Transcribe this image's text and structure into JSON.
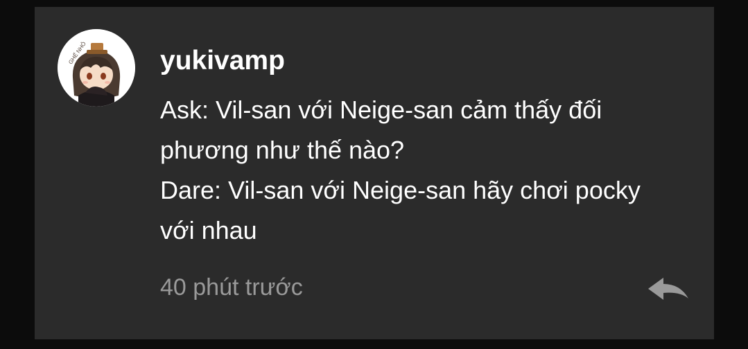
{
  "comment": {
    "username": "yukivamp",
    "message_lines": [
      "Ask: Vil-san với Neige-san cảm thấy đối",
      "phương như thế nào?",
      "Dare: Vil-san với Neige-san hãy chơi pocky",
      "với nhau"
    ],
    "timestamp": "40 phút trước",
    "avatar_text": "GHẾ NHỎ",
    "reply_icon": "reply-arrow-icon"
  },
  "colors": {
    "page_background": "#0c0c0c",
    "card_background": "#2b2b2b",
    "text_primary": "#ffffff",
    "text_secondary": "#9a9a9a",
    "icon": "#9a9a9a"
  }
}
